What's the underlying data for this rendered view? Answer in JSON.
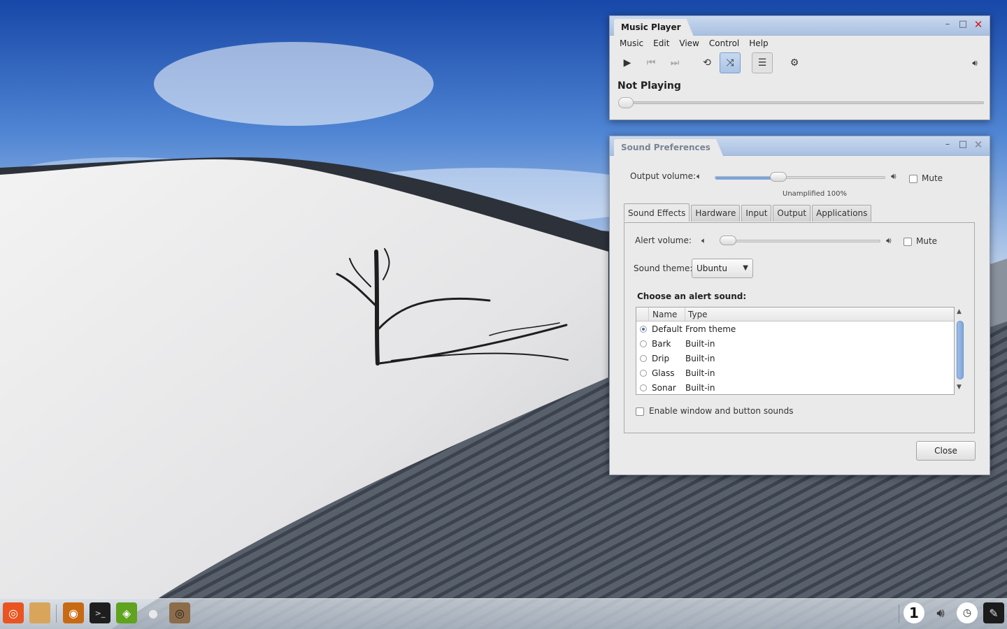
{
  "music_player": {
    "title": "Music Player",
    "menu": [
      "Music",
      "Edit",
      "View",
      "Control",
      "Help"
    ],
    "toolbar": {
      "play_icon": "play-icon",
      "prev_icon": "skip-back-icon",
      "next_icon": "skip-forward-icon",
      "repeat_icon": "repeat-icon",
      "shuffle_icon": "shuffle-icon",
      "playlist_icon": "playlist-icon",
      "settings_icon": "gear-icon",
      "volume_icon": "volume-icon"
    },
    "status": "Not Playing",
    "progress": 0
  },
  "sound_prefs": {
    "title": "Sound Preferences",
    "output_volume_label": "Output volume:",
    "output_volume_value": 0.36,
    "mute_label": "Mute",
    "unamplified_label": "Unamplified",
    "unamplified_percent": "100%",
    "tabs": [
      "Sound Effects",
      "Hardware",
      "Input",
      "Output",
      "Applications"
    ],
    "active_tab": "Sound Effects",
    "alert_volume_label": "Alert volume:",
    "alert_volume_value": 0.0,
    "sound_theme_label": "Sound theme:",
    "sound_theme_value": "Ubuntu",
    "choose_alert_label": "Choose an alert sound:",
    "columns": {
      "name": "Name",
      "type": "Type"
    },
    "alert_sounds": [
      {
        "name": "Default",
        "type": "From theme",
        "selected": true
      },
      {
        "name": "Bark",
        "type": "Built-in",
        "selected": false
      },
      {
        "name": "Drip",
        "type": "Built-in",
        "selected": false
      },
      {
        "name": "Glass",
        "type": "Built-in",
        "selected": false
      },
      {
        "name": "Sonar",
        "type": "Built-in",
        "selected": false
      }
    ],
    "enable_sounds_label": "Enable window and button sounds",
    "close_label": "Close"
  },
  "taskbar": {
    "workspace_number": "1",
    "accent": "#e95420"
  }
}
